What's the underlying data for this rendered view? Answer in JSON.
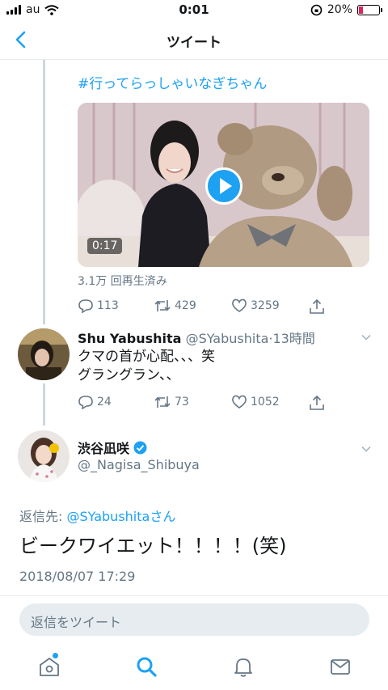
{
  "status_bar": {
    "carrier": "au",
    "time": "0:01",
    "battery": "20%",
    "battery_level": 0.2
  },
  "header": {
    "title": "ツイート"
  },
  "quoted_media": {
    "hashtag": "#行ってらっしゃいなぎちゃん",
    "video_duration": "0:17",
    "views": "3.1万 回再生済み",
    "reply_count": "113",
    "retweet_count": "429",
    "like_count": "3259"
  },
  "reply_tweet": {
    "name": "Shu Yabushita",
    "handle_time": "@SYabushita·13時間",
    "text_line1": "クマの首が心配、、、笑",
    "text_line2": "グラングラン、、",
    "reply_count": "24",
    "retweet_count": "73",
    "like_count": "1052"
  },
  "main_tweet": {
    "name": "渋谷凪咲",
    "handle": "@_Nagisa_Shibuya",
    "reply_to_label": "返信先: ",
    "reply_to_mention": "@SYabushita",
    "reply_to_suffix": "さん",
    "text": "ビークワイエット！！！！(笑)",
    "timestamp": "2018/08/07 17:29"
  },
  "composer": {
    "placeholder": "返信をツイート"
  },
  "tabs": [
    "home-icon",
    "search-icon",
    "notifications-icon",
    "messages-icon"
  ],
  "colors": {
    "accent": "#1da1f2",
    "muted": "#657786",
    "battery_low": "#e0245e"
  }
}
